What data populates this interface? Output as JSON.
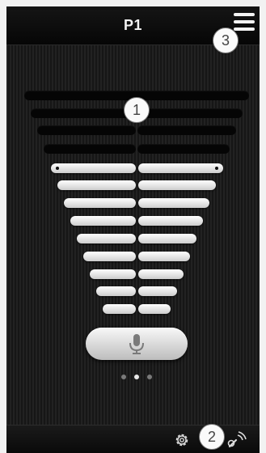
{
  "header": {
    "title": "P1",
    "menu_icon": "hamburger-menu-icon"
  },
  "callouts": [
    "1",
    "2",
    "3"
  ],
  "equalizer": {
    "rows": 12,
    "lit_rows": 8,
    "colors": {
      "lit": "#eeeeee",
      "unlit": "#050505"
    }
  },
  "mic_button": {
    "icon": "microphone-icon"
  },
  "pagination": {
    "pages": 3,
    "active_index": 1
  },
  "bottom_bar": {
    "settings_icon": "gear-icon",
    "connection_icon": "wireless-signal-icon"
  },
  "colors": {
    "background": "#1c1c1c",
    "bar_background": "#0a0a0a",
    "text": "#f2f2f2"
  }
}
